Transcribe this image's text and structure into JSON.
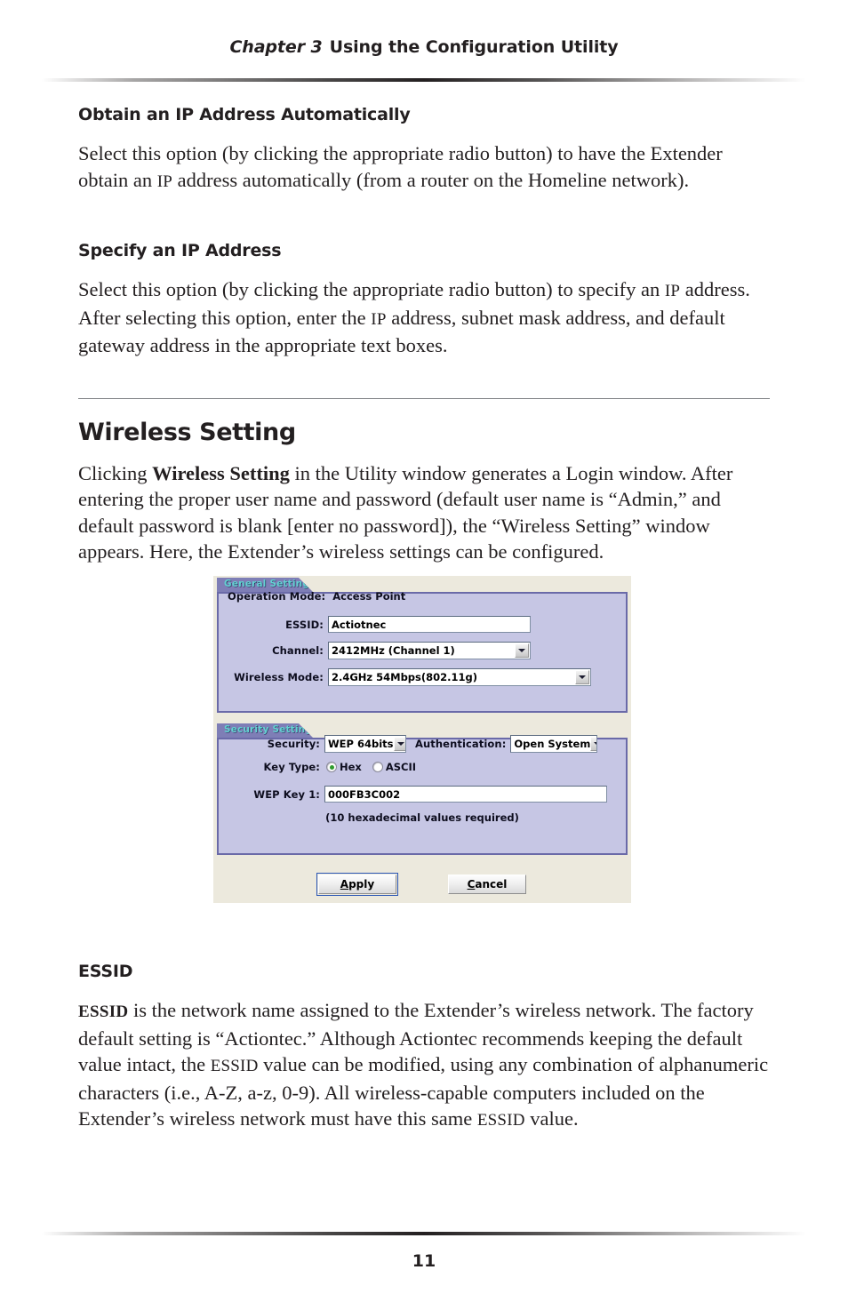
{
  "page": {
    "running_head_chapter": "Chapter 3",
    "running_head_title": "Using the Configuration Utility",
    "folio": "11"
  },
  "sections": [
    {
      "heading": "Obtain an IP Address Automatically",
      "body_line_1": "Select this option (by clicking the appropriate radio button) to have the Extender",
      "body_line_2_a": "obtain an ",
      "body_line_2_sc": "IP",
      "body_line_2_b": " address automatically (from a router on the Homeline network)."
    },
    {
      "heading": "Specify an IP Address",
      "body_line_1_a": "Select this option (by clicking the appropriate radio button) to specify an ",
      "body_line_1_sc": "IP",
      "body_line_2_a": "address. After selecting this option, enter the ",
      "body_line_2_sc": "IP",
      "body_line_2_b": " address, subnet mask address, and",
      "body_line_3": "default gateway address in the appropriate text boxes."
    }
  ],
  "wireless_section": {
    "heading": "Wireless Setting",
    "para_a": "Clicking ",
    "para_bold": "Wireless Setting",
    "para_b": " in the Utility window generates a Login window. After entering the proper user name and password (default user name is “Admin,” and default password is blank [enter no password]), the “Wireless Setting” window appears. Here, the Extender’s wireless settings can be configured."
  },
  "essid_section": {
    "heading": "ESSID",
    "para_sc": "ESSID",
    "para_a": " is the network name assigned to the Extender’s wireless network. The factory default setting is “Actiontec.” Although Actiontec recommends keeping the default value intact, the ",
    "para_sc2": "ESSID",
    "para_b": " value can be modified, using any combination of alphanumeric characters (i.e., A-Z, a-z, 0-9). All wireless-capable computers included on the Extender’s wireless network must have this same ",
    "para_sc3": "ESSID",
    "para_c": " value."
  },
  "screenshot": {
    "general_setting": {
      "tab_label": "General Setting",
      "operation_mode_label": "Operation Mode:",
      "operation_mode_value": "Access Point",
      "essid_label": "ESSID:",
      "essid_value": "Actiotnec",
      "channel_label": "Channel:",
      "channel_value": "2412MHz (Channel 1)",
      "wireless_mode_label": "Wireless Mode:",
      "wireless_mode_value": "2.4GHz 54Mbps(802.11g)"
    },
    "security_setting": {
      "tab_label": "Security Setting",
      "security_label": "Security:",
      "security_value": "WEP 64bits",
      "authentication_label": "Authentication:",
      "authentication_value": "Open System",
      "key_type_label": "Key Type:",
      "key_type_hex": "Hex",
      "key_type_ascii": "ASCII",
      "key_type_selected": "Hex",
      "wep_key_label": "WEP Key 1:",
      "wep_key_value": "000FB3C002",
      "wep_key_hint": "(10 hexadecimal values required)"
    },
    "buttons": {
      "apply_accel": "A",
      "apply_rest": "pply",
      "cancel_accel": "C",
      "cancel_rest": "ancel"
    },
    "colors": {
      "dialog_background": "#ece9dd",
      "panel_fill": "#c6c6e4",
      "panel_border": "#6a6aa8",
      "tab_fill": "#7e7eb6",
      "tab_text": "#63d2d2",
      "radio_dot": "#2f9b2f",
      "default_button_focus": "#2a56b5"
    }
  }
}
